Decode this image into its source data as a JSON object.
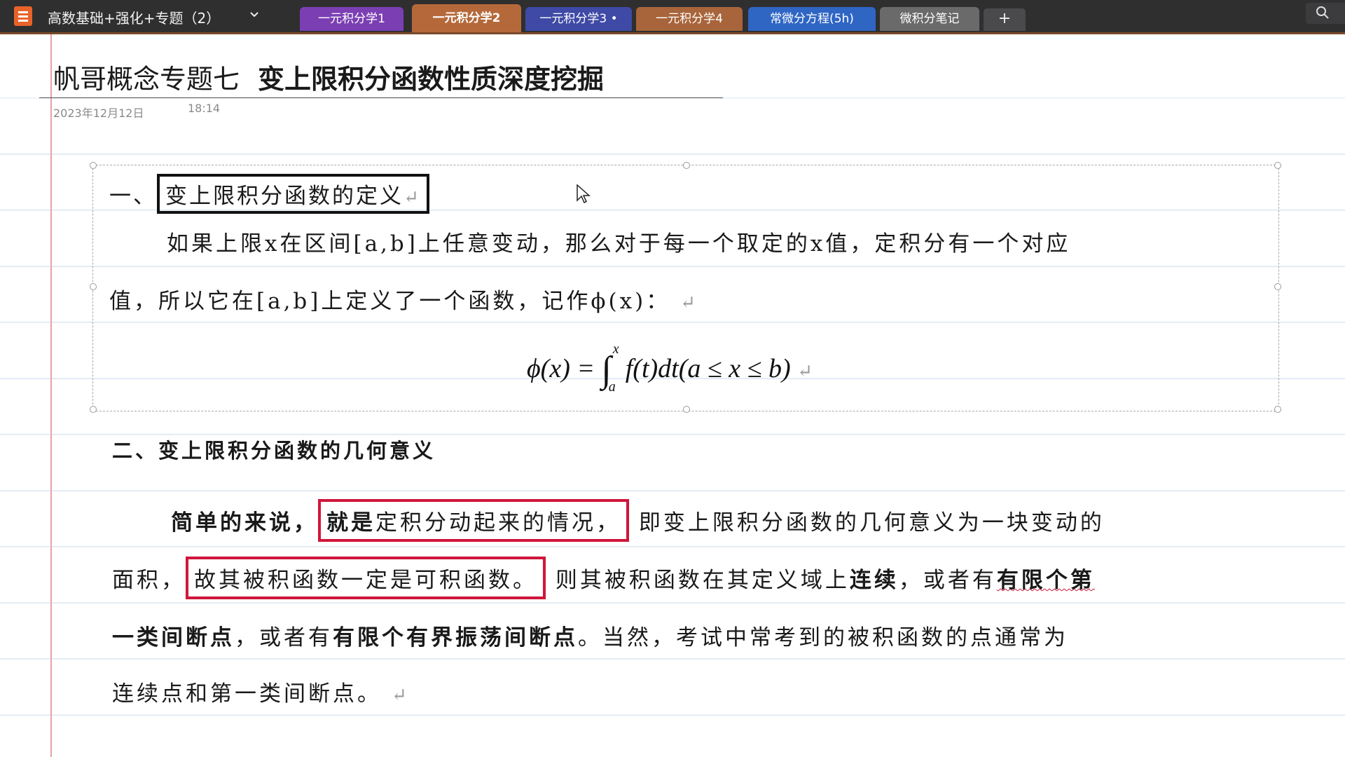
{
  "app": {
    "notebook_title": "高数基础+强化+专题（2）",
    "brand_color": "#e8632a"
  },
  "tabs": [
    {
      "label": "一元积分学1",
      "color": "#7b3fb3",
      "active": false
    },
    {
      "label": "一元积分学2",
      "color": "#b5693a",
      "active": true
    },
    {
      "label": "一元积分学3 •",
      "color": "#3f4aa6",
      "active": false
    },
    {
      "label": "一元积分学4",
      "color": "#a8643a",
      "active": false
    },
    {
      "label": "常微分方程(5h)",
      "color": "#2f66c4",
      "active": false
    },
    {
      "label": "微积分笔记",
      "color": "#6a6a6a",
      "active": false
    }
  ],
  "add_tab_label": "+",
  "page": {
    "title_part1": "帆哥概念专题七",
    "title_part2": "变上限积分函数性质深度挖掘",
    "date": "2023年12月12日",
    "time": "18:14"
  },
  "section1": {
    "heading_prefix": "一、",
    "heading_boxed": "变上限积分函数的定义",
    "para_line1": "如果上限x在区间[a,b]上任意变动，那么对于每一个取定的x值，定积分有一个对应",
    "para_line2": "值，所以它在[a,b]上定义了一个函数，记作ϕ(x)：",
    "formula_lhs": "ϕ(x) = ",
    "formula_int": "∫",
    "formula_upper": "x",
    "formula_lower": "a",
    "formula_rhs": "f(t)dt(a ≤ x ≤ b)"
  },
  "section2": {
    "heading": "二、变上限积分函数的几何意义",
    "l1_bold": "简单的来说，",
    "l1_box_bold": "就是",
    "l1_box_rest": "定积分动起来的情况，",
    "l1_rest": "即变上限积分函数的几何意义为一块变动的",
    "l2_start": "面积，",
    "l2_box": "故其被积函数一定是可积函数。",
    "l2_mid": "则其被积函数在其定义域上",
    "l2_bold1": "连续",
    "l2_mid2": "，或者有",
    "l2_bold2": "有限个第",
    "l3_bold1": "一类间断点",
    "l3_mid": "，或者有",
    "l3_bold2": "有限个有界振荡间断点",
    "l3_rest": "。当然，考试中常考到的被积函数的点通常为",
    "l4": "连续点和第一类间断点。"
  },
  "return_mark": "↵"
}
